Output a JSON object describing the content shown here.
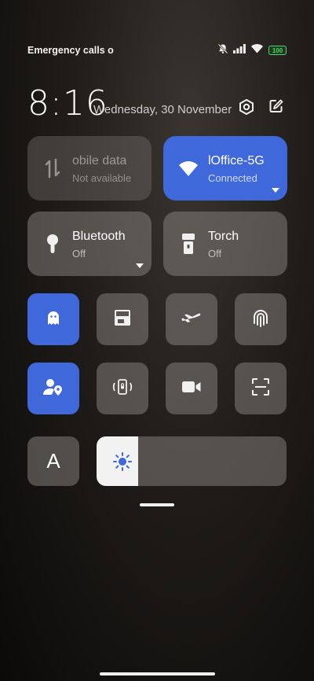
{
  "status_bar": {
    "left_text": "Emergency calls o",
    "battery": "100",
    "battery_color": "#54d36b"
  },
  "header": {
    "time": "8:16",
    "date": "Wednesday, 30 November"
  },
  "tiles": [
    {
      "title": "obile data",
      "subtitle": "Not available"
    },
    {
      "title": "lOffice-5G",
      "subtitle": "Connected"
    },
    {
      "title": "Bluetooth",
      "subtitle": "Off"
    },
    {
      "title": "Torch",
      "subtitle": "Off"
    }
  ],
  "brightness": {
    "level": 0.22,
    "auto_label": "A"
  },
  "colors": {
    "accent": "#3f68db"
  }
}
